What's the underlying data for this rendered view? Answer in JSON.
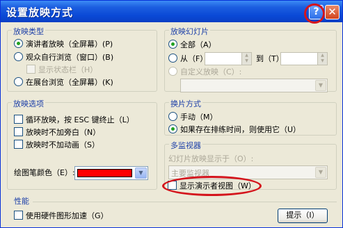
{
  "window": {
    "title": "设置放映方式",
    "help_label": "?",
    "close_label": "✕"
  },
  "show_type": {
    "legend": "放映类型",
    "options": [
      "演讲者放映（全屏幕）(P)",
      "观众自行浏览（窗口）(B)",
      "在展台浏览（全屏幕）(K)"
    ],
    "selected_index": 0,
    "show_scrollbar": "显示状态栏（H）"
  },
  "show_slides": {
    "legend": "放映幻灯片",
    "all": "全部（A）",
    "from": "从（F）:",
    "to": "到（T）:",
    "custom": "自定义放映（C）:"
  },
  "show_options": {
    "legend": "放映选项",
    "items": [
      "循环放映，按 ESC 键终止（L）",
      "放映时不加旁白（N）",
      "放映时不加动画（S）"
    ],
    "pen_color_label": "绘图笔颜色（E）:",
    "pen_color": "#ff0000"
  },
  "advance": {
    "legend": "换片方式",
    "manual": "手动（M）",
    "timings": "如果存在排练时间，则使用它（U）"
  },
  "multi_monitor": {
    "legend": "多监视器",
    "display_on": "幻灯片放映显示于（O）:",
    "display_value": "主要监视器",
    "presenter_view": "显示演示者视图（W）"
  },
  "performance": {
    "legend": "性能",
    "hardware_accel": "使用硬件图形加速（G）",
    "tips_button": "提示（I）"
  },
  "colors": {
    "title_bar": "#0a49d6",
    "dialog_bg": "#ece9d8",
    "group_label": "#1c3fa8",
    "annotation_red": "#d4141c"
  }
}
